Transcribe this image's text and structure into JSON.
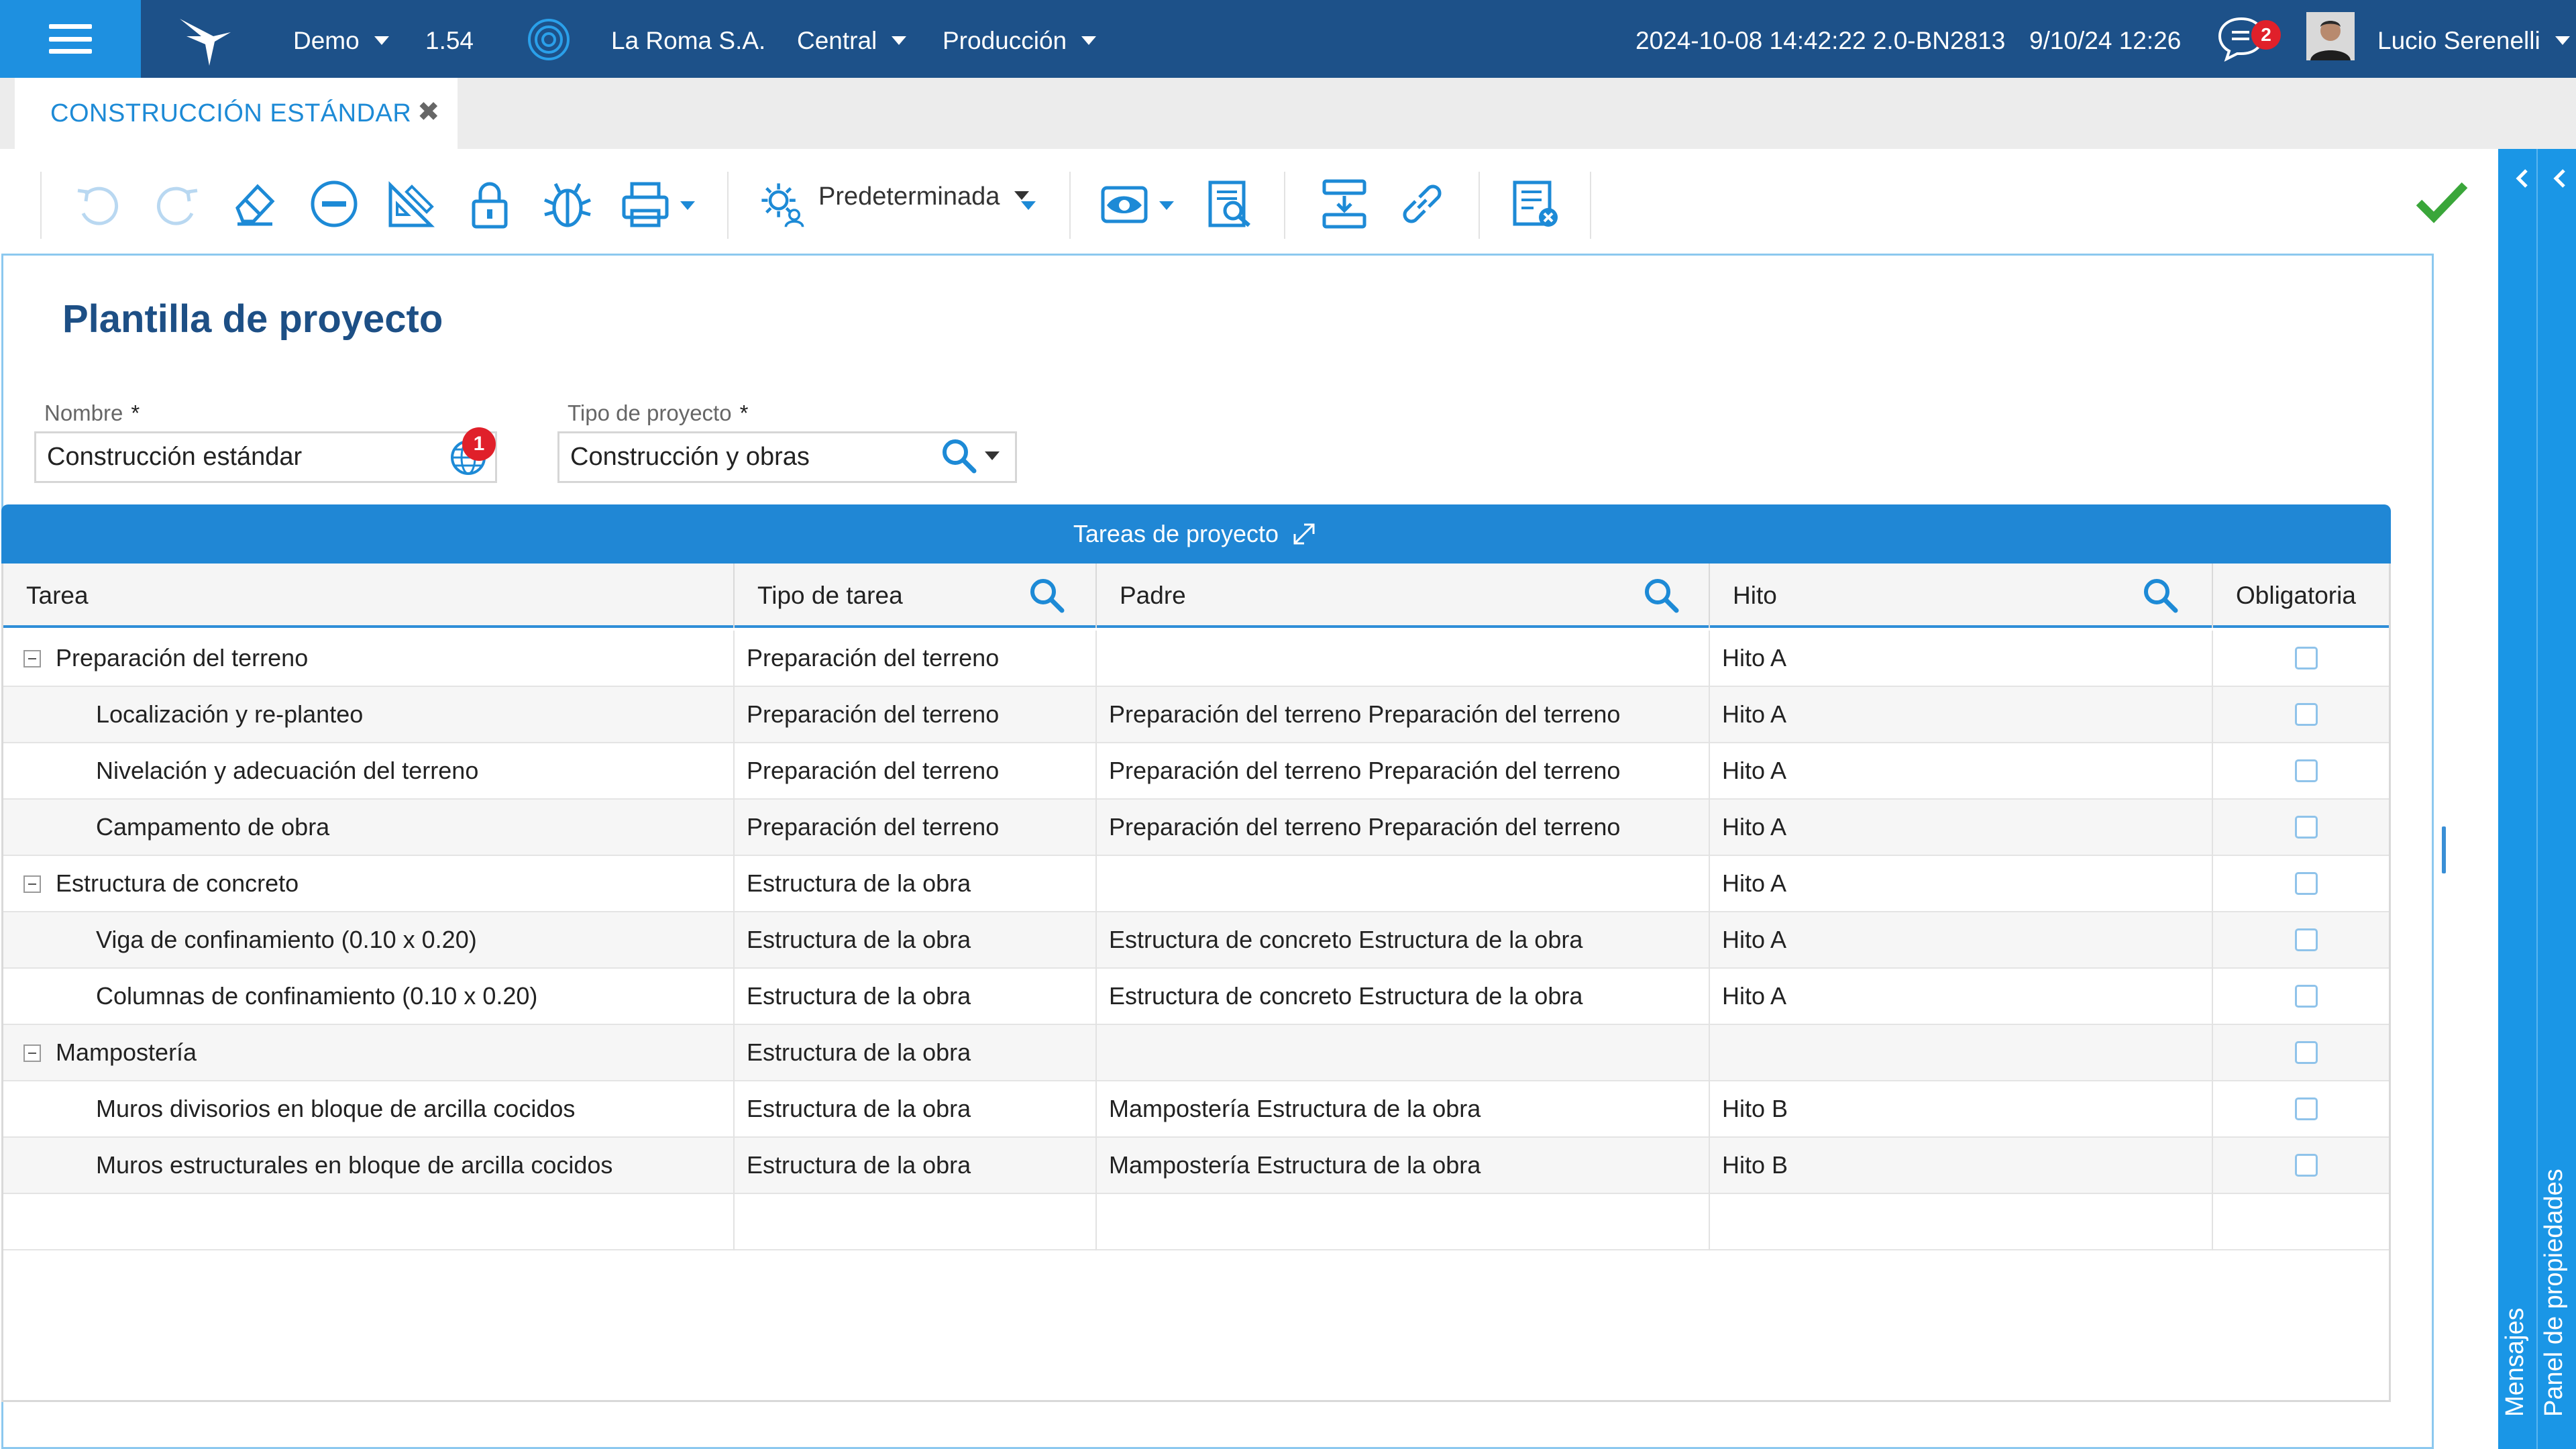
{
  "topbar": {
    "environment": "Demo",
    "version": "1.54",
    "company": "La Roma S.A.",
    "branch": "Central",
    "mode": "Producción",
    "build_info": "2024-10-08 14:42:22 2.0-BN2813",
    "session_date": "9/10/24 12:26",
    "notifications_count": "2",
    "user_name": "Lucio Serenelli"
  },
  "tabs": [
    {
      "label": "CONSTRUCCIÓN ESTÁNDAR",
      "close_glyph": "✖"
    }
  ],
  "toolbar": {
    "view_label": "Predeterminada",
    "icons": [
      "undo-icon",
      "redo-icon",
      "eraser-icon",
      "remove-circle-icon",
      "design-icon",
      "lock-icon",
      "bug-icon",
      "print-icon",
      "settings-user-icon",
      "eye-icon",
      "document-search-icon",
      "insert-row-icon",
      "link-icon",
      "list-delete-icon",
      "checkmark-icon"
    ]
  },
  "side_panel": {
    "label_messages": "Mensajes",
    "label_properties": "Panel de propiedades"
  },
  "form": {
    "title": "Plantilla de proyecto",
    "name_label": "Nombre",
    "name_required": "*",
    "name_value": "Construcción estándar",
    "name_badge": "1",
    "type_label": "Tipo de proyecto",
    "type_required": "*",
    "type_value": "Construcción y obras"
  },
  "grid": {
    "title": "Tareas de proyecto",
    "columns": [
      "Tarea",
      "Tipo de tarea",
      "Padre",
      "Hito",
      "Obligatoria"
    ],
    "rows": [
      {
        "tarea": "Preparación del terreno",
        "tipo": "Preparación del terreno",
        "padre": "",
        "hito": "Hito A",
        "obligatoria": false,
        "level": 0
      },
      {
        "tarea": "Localización y re-planteo",
        "tipo": "Preparación del terreno",
        "padre": "Preparación del terreno Preparación del terreno",
        "hito": "Hito A",
        "obligatoria": false,
        "level": 1
      },
      {
        "tarea": "Nivelación y adecuación del terreno",
        "tipo": "Preparación del terreno",
        "padre": "Preparación del terreno Preparación del terreno",
        "hito": "Hito A",
        "obligatoria": false,
        "level": 1
      },
      {
        "tarea": "Campamento de obra",
        "tipo": "Preparación del terreno",
        "padre": "Preparación del terreno Preparación del terreno",
        "hito": "Hito A",
        "obligatoria": false,
        "level": 1
      },
      {
        "tarea": "Estructura de concreto",
        "tipo": "Estructura de la obra",
        "padre": "",
        "hito": "Hito A",
        "obligatoria": false,
        "level": 0
      },
      {
        "tarea": "Viga de confinamiento (0.10 x 0.20)",
        "tipo": "Estructura de la obra",
        "padre": "Estructura de concreto Estructura de la obra",
        "hito": "Hito A",
        "obligatoria": false,
        "level": 1
      },
      {
        "tarea": "Columnas de confinamiento (0.10 x 0.20)",
        "tipo": "Estructura de la obra",
        "padre": "Estructura de concreto Estructura de la obra",
        "hito": "Hito A",
        "obligatoria": false,
        "level": 1
      },
      {
        "tarea": "Mampostería",
        "tipo": "Estructura de la obra",
        "padre": "",
        "hito": "",
        "obligatoria": false,
        "level": 0
      },
      {
        "tarea": "Muros divisorios en bloque de arcilla cocidos",
        "tipo": "Estructura de la obra",
        "padre": "Mampostería Estructura de la obra",
        "hito": "Hito B",
        "obligatoria": false,
        "level": 1
      },
      {
        "tarea": "Muros estructurales en bloque de arcilla cocidos",
        "tipo": "Estructura de la obra",
        "padre": "Mampostería Estructura de la obra",
        "hito": "Hito B",
        "obligatoria": false,
        "level": 1
      }
    ]
  },
  "colors": {
    "topbar": "#1d5189",
    "accent": "#1e90e0",
    "grid_header": "#2087d5",
    "badge": "#e0202a",
    "success": "#3aa63a"
  }
}
